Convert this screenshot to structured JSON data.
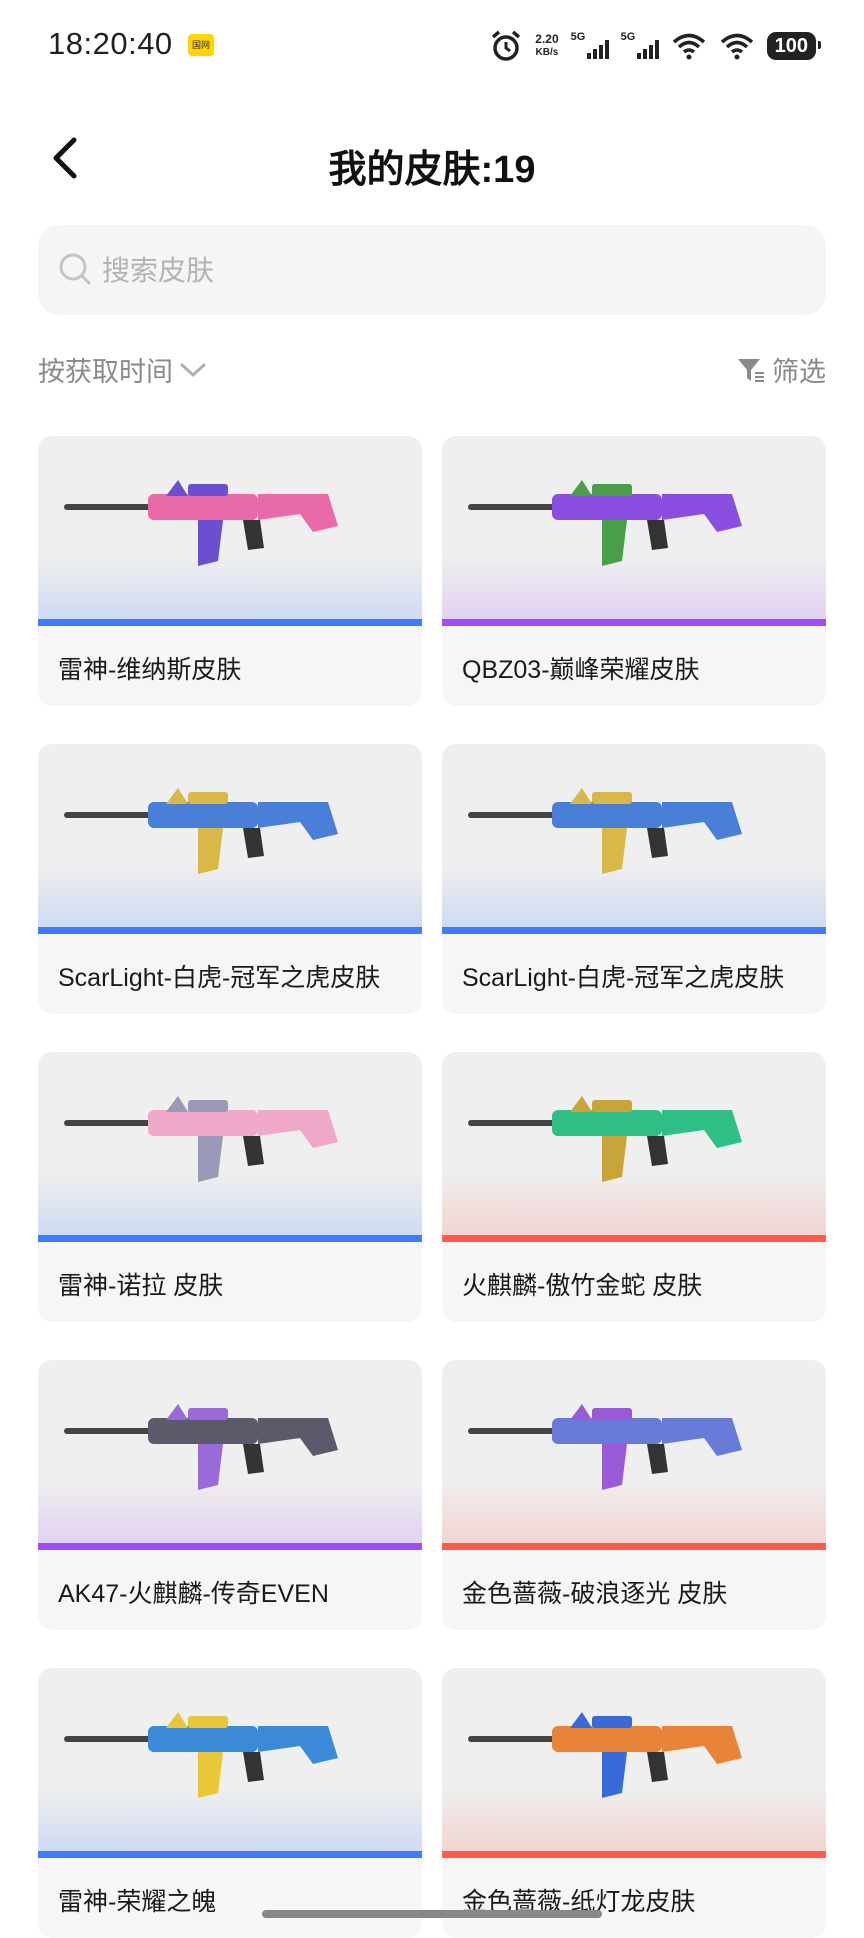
{
  "status_bar": {
    "time": "18:20:40",
    "badge": "国网",
    "net_speed": "2.20",
    "net_unit": "KB/s",
    "net1": "5G",
    "net2": "5G",
    "battery": "100"
  },
  "header": {
    "title": "我的皮肤:19",
    "back_icon": "back-chevron-icon"
  },
  "search": {
    "placeholder": "搜索皮肤",
    "value": ""
  },
  "sort": {
    "label": "按获取时间"
  },
  "filter": {
    "label": "筛选"
  },
  "skins": [
    {
      "name": "雷神-维纳斯皮肤",
      "rarity_color": "#3f7bff"
    },
    {
      "name": "QBZ03-巅峰荣耀皮肤",
      "rarity_color": "#a24cff"
    },
    {
      "name": "ScarLight-白虎-冠军之虎皮肤",
      "rarity_color": "#3f7bff"
    },
    {
      "name": "ScarLight-白虎-冠军之虎皮肤",
      "rarity_color": "#3f7bff"
    },
    {
      "name": "雷神-诺拉 皮肤",
      "rarity_color": "#3f7bff"
    },
    {
      "name": "火麒麟-傲竹金蛇 皮肤",
      "rarity_color": "#ff5a4a"
    },
    {
      "name": "AK47-火麒麟-传奇EVEN",
      "rarity_color": "#a24cff"
    },
    {
      "name": "金色蔷薇-破浪逐光 皮肤",
      "rarity_color": "#ff5a4a"
    },
    {
      "name": "雷神-荣耀之魄",
      "rarity_color": "#3f7bff"
    },
    {
      "name": "金色蔷薇-纸灯龙皮肤",
      "rarity_color": "#ff5a4a"
    }
  ]
}
